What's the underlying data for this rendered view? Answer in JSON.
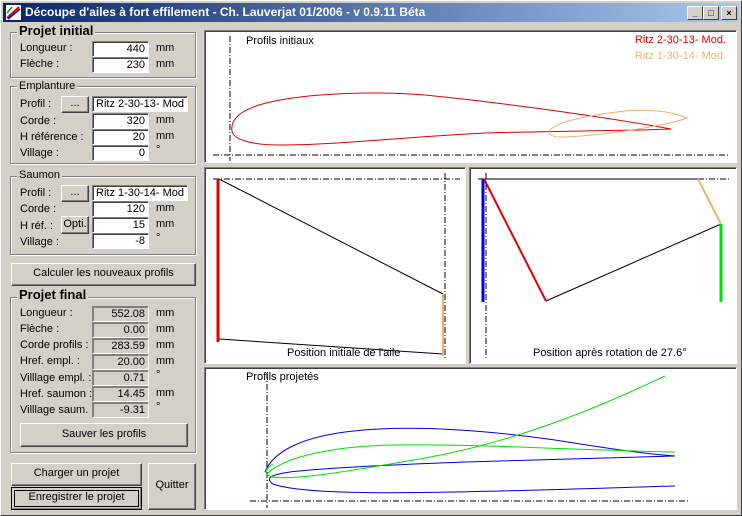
{
  "window": {
    "title": "Découpe d'ailes à fort effilement - Ch. Lauverjat 01/2006 - v 0.9.11 Béta",
    "controls": {
      "minimize": "_",
      "maximize": "□",
      "close": "×"
    }
  },
  "projet_initial": {
    "title": "Projet initial",
    "longueur": {
      "label": "Longueur :",
      "value": "440",
      "unit": "mm"
    },
    "fleche": {
      "label": "Flèche :",
      "value": "230",
      "unit": "mm"
    }
  },
  "emplanture": {
    "title": "Emplanture",
    "profil": {
      "label": "Profil :",
      "button": "...",
      "value": "Ritz 2-30-13- Mod"
    },
    "corde": {
      "label": "Corde :",
      "value": "320",
      "unit": "mm"
    },
    "h_ref": {
      "label": "H référence :",
      "value": "20",
      "unit": "mm"
    },
    "village": {
      "label": "Village :",
      "value": "0",
      "unit": "°"
    }
  },
  "saumon": {
    "title": "Saumon",
    "profil": {
      "label": "Profil :",
      "button": "...",
      "value": "Ritz 1-30-14- Mod"
    },
    "corde": {
      "label": "Corde :",
      "value": "120",
      "unit": "mm"
    },
    "h_ref": {
      "label": "H réf. :",
      "button": "Opti.",
      "value": "15",
      "unit": "mm"
    },
    "village": {
      "label": "Village :",
      "value": "-8",
      "unit": "°"
    }
  },
  "calc_button": "Calculer les nouveaux profils",
  "projet_final": {
    "title": "Projet final",
    "rows": [
      {
        "label": "Longueur :",
        "value": "552.08",
        "unit": "mm"
      },
      {
        "label": "Flèche :",
        "value": "0.00",
        "unit": "mm"
      },
      {
        "label": "Corde profils :",
        "value": "283.59",
        "unit": "mm"
      },
      {
        "label": "Href. empl. :",
        "value": "20.00",
        "unit": "mm"
      },
      {
        "label": "Villlage empl. :",
        "value": "0.71",
        "unit": "°"
      },
      {
        "label": "Href. saumon :",
        "value": "14.45",
        "unit": "mm"
      },
      {
        "label": "Villlage saum. :",
        "value": "-9.31",
        "unit": "°"
      }
    ],
    "save_button": "Sauver les profils"
  },
  "bottom": {
    "load_button": "Charger un projet",
    "save_project_button": "Enregistrer le projet",
    "quit_button": "Quitter"
  },
  "panels": {
    "initial_profiles": {
      "title": "Profils initiaux",
      "legend": [
        {
          "name": "Ritz 2-30-13- Mod.",
          "color": "#e00000"
        },
        {
          "name": "Ritz 1-30-14- Mod.",
          "color": "#f0b070"
        }
      ]
    },
    "initial_position": {
      "caption": "Position initiale de l'aile",
      "root_color": "#e00000",
      "tip_color": "#f0b070"
    },
    "rotated_position": {
      "caption": "Position après rotation de 27.6°",
      "root_color": "#0000e0",
      "tip_color": "#00e000",
      "old_root_color": "#e00000",
      "old_tip_color": "#f0b070"
    },
    "projected_profiles": {
      "title": "Profils projetés",
      "series_colors": [
        "#0000e0",
        "#00e000"
      ]
    }
  }
}
